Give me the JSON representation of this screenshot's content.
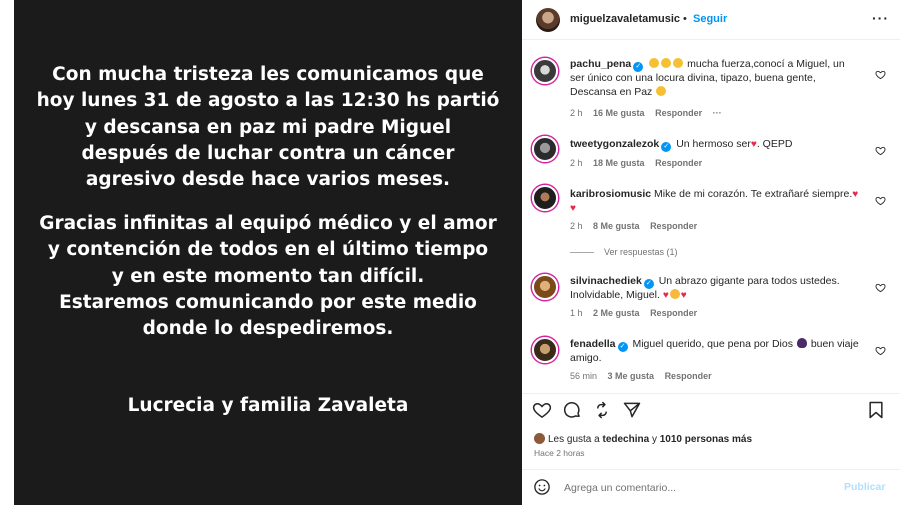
{
  "post": {
    "paragraph1": [
      "Con mucha tristeza les comunicamos que",
      "hoy lunes 31 de agosto a las 12:30 hs partió",
      "y descansa en paz mi padre Miguel",
      "después de luchar contra un cáncer",
      "agresivo desde hace varios meses."
    ],
    "paragraph2": [
      "Gracias infinitas al equipó médico y el amor",
      "y contención de todos en el último tiempo",
      "y en este momento tan difícil.",
      "Estaremos comunicando por este medio",
      "donde lo despediremos."
    ],
    "signature": "Lucrecia y familia Zavaleta"
  },
  "header": {
    "username": "miguelzavaletamusic",
    "separator": "•",
    "follow_label": "Seguir",
    "more_label": "···"
  },
  "comments": [
    {
      "username": "pachu_pena",
      "text": "mucha fuerza,conocí a Miguel, un ser único con una locura divina, tipazo, buena gente, Descansa en Paz",
      "time": "2 h",
      "likes": "16 Me gusta",
      "reply": "Responder",
      "more": "···"
    },
    {
      "username": "tweetygonzalezok",
      "text": "Un hermoso ser",
      "text_after": ". QEPD",
      "time": "2 h",
      "likes": "18 Me gusta",
      "reply": "Responder"
    },
    {
      "username": "karibrosiomusic",
      "text": "Mike de mi corazón. Te extrañaré siempre.",
      "time": "2 h",
      "likes": "8 Me gusta",
      "reply": "Responder"
    },
    {
      "username": "silvinachediek",
      "text": "Un abrazo gigante para todos ustedes. Inolvidable, Miguel.",
      "time": "1 h",
      "likes": "2 Me gusta",
      "reply": "Responder"
    },
    {
      "username": "fenadella",
      "text": "Miguel querido, que pena por Dios",
      "text_after": "buen viaje amigo.",
      "time": "56 min",
      "likes": "3 Me gusta",
      "reply": "Responder"
    }
  ],
  "view_replies_label": "Ver respuestas (1)",
  "likes_summary": {
    "prefix": "Les gusta a",
    "user": "tedechina",
    "connector": "y",
    "count": "1010 personas más"
  },
  "time_ago": "Hace 2 horas",
  "comment_box": {
    "placeholder": "Agrega un comentario...",
    "publish_label": "Publicar"
  },
  "icons": {
    "like": "heart-outline-icon",
    "comment": "comment-bubble-icon",
    "share": "repost-icon",
    "send": "paper-plane-icon",
    "save": "bookmark-icon",
    "emoji": "smiley-icon"
  },
  "colors": {
    "post_bg": "#1b1b1b",
    "link_blue": "#0095f6",
    "publish_disabled": "#b2dffc",
    "muted_text": "#737373",
    "heart_red": "#e8294b"
  }
}
